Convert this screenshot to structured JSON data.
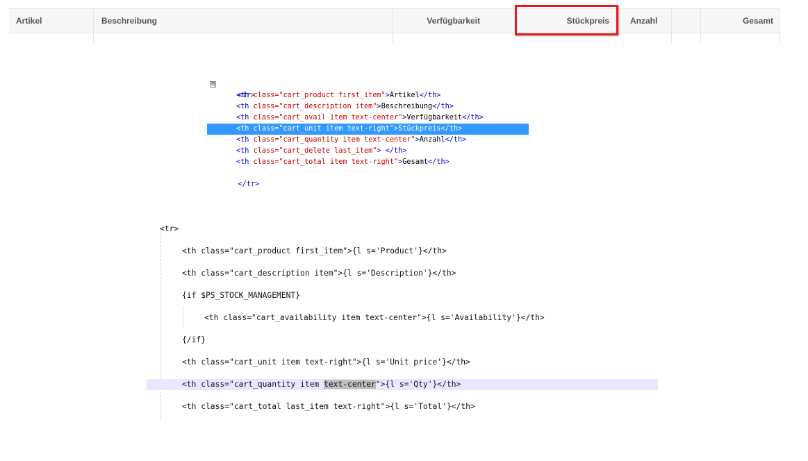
{
  "cart_table": {
    "headers": {
      "product": "Artikel",
      "description": "Beschreibung",
      "availability": "Verfügbarkeit",
      "unit_price": "Stückpreis",
      "quantity": "Anzahl",
      "delete": "",
      "total": "Gesamt"
    },
    "highlight_color": "#e21b1b"
  },
  "dom_inspector": {
    "open_tag": "<tr>",
    "close_tag": "</tr>",
    "toggle_symbol": "⊟",
    "rows": [
      {
        "class_value": "cart_product first_item",
        "text": "Artikel"
      },
      {
        "class_value": "cart_description item",
        "text": "Beschreibung"
      },
      {
        "class_value": "cart_avail item text-center",
        "text": "Verfügbarkeit"
      },
      {
        "class_value": "cart_unit item text-right",
        "text": "Stückpreis"
      },
      {
        "class_value": "cart_quantity item text-center",
        "text": "Anzahl"
      },
      {
        "class_value": "cart_delete last_item",
        "text": " "
      },
      {
        "class_value": "cart_total item text-right",
        "text": "Gesamt"
      }
    ],
    "selected_row": 3,
    "selection_color": "#3399ff"
  },
  "template_source": {
    "lines": [
      "<tr>",
      "<th class=\"cart_product first_item\">{l s='Product'}</th>",
      "<th class=\"cart_description item\">{l s='Description'}</th>",
      "{if $PS_STOCK_MANAGEMENT}",
      "<th class=\"cart_availability item text-center\">{l s='Availability'}</th>",
      "{/if}",
      "<th class=\"cart_unit item text-right\">{l s='Unit price'}</th>",
      "<th class=\"cart_quantity item ",
      "text-center",
      "\">{l s='Qty'}</th>",
      "<th class=\"cart_total last_item text-right\">{l s='Total'}</th>"
    ],
    "active_line_color": "#e8e8ff"
  }
}
